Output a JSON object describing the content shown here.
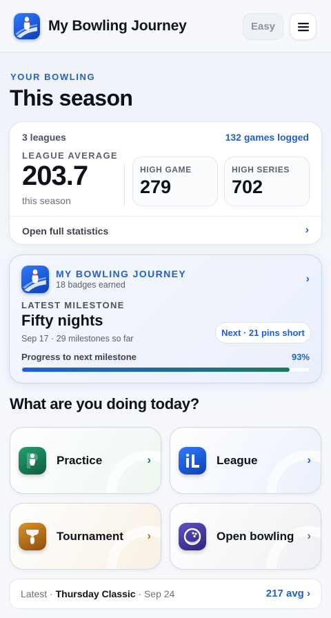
{
  "header": {
    "app_title": "My Bowling Journey",
    "mode_label": "Easy",
    "logo_icon": "bowling-pin-lane-icon",
    "menu_icon": "hamburger-menu-icon"
  },
  "hero": {
    "eyebrow": "YOUR BOWLING",
    "title": "This season"
  },
  "stats": {
    "leagues": "3 leagues",
    "games_logged": "132 games logged",
    "average_label": "LEAGUE AVERAGE",
    "average_value": "203.7",
    "average_sub": "this season",
    "high_game_label": "HIGH GAME",
    "high_game_value": "279",
    "high_series_label": "HIGH SERIES",
    "high_series_value": "702",
    "open_label": "Open full statistics",
    "chevron": "›"
  },
  "journey": {
    "title": "MY BOWLING JOURNEY",
    "badges": "18 badges earned",
    "milestone_label": "LATEST MILESTONE",
    "milestone_name": "Fifty nights",
    "milestone_meta": "Sep 17 · 29 milestones so far",
    "next_pill": "Next · 21 pins short",
    "progress_label": "Progress to next milestone",
    "progress_pct": "93%",
    "progress_value": 0.93,
    "chevron": "›"
  },
  "question": "What are you doing today?",
  "actions": [
    {
      "label": "Practice",
      "icon": "practice-pin-icon",
      "color": "#1a7a55",
      "chevron": "›"
    },
    {
      "label": "League",
      "icon": "league-icon",
      "color": "#1f5fd6",
      "chevron": "›"
    },
    {
      "label": "Tournament",
      "icon": "tournament-trophy-icon",
      "color": "#b8731a",
      "chevron": "›"
    },
    {
      "label": "Open bowling",
      "icon": "bowling-ball-icon",
      "color": "#4b3fa8",
      "chevron": "›"
    }
  ],
  "latest": {
    "prefix": "Latest",
    "sep1": "·",
    "name": "Thursday Classic",
    "date": "· Sep 24",
    "avg": "217 avg ›"
  },
  "colors": {
    "accent": "#1f5fd6",
    "practice": "#1a7a55",
    "tournament": "#b8731a",
    "open_bowling": "#4b3fa8"
  }
}
